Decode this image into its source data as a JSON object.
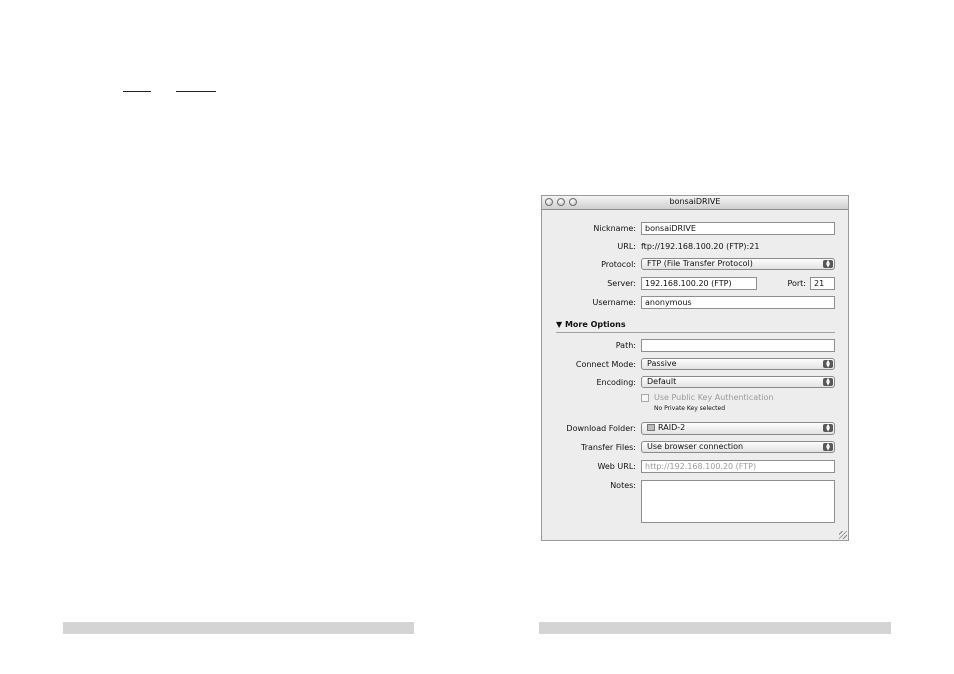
{
  "window": {
    "title": "bonsaiDRIVE"
  },
  "form": {
    "nickname": {
      "label": "Nickname:",
      "value": "bonsaiDRIVE"
    },
    "url": {
      "label": "URL:",
      "value": "ftp://192.168.100.20 (FTP):21"
    },
    "protocol": {
      "label": "Protocol:",
      "value": "FTP (File Transfer Protocol)"
    },
    "server": {
      "label": "Server:",
      "value": "192.168.100.20 (FTP)"
    },
    "port": {
      "label": "Port:",
      "value": "21"
    },
    "username": {
      "label": "Username:",
      "value": "anonymous"
    }
  },
  "more_options": {
    "title": "More Options",
    "path": {
      "label": "Path:",
      "value": ""
    },
    "connect_mode": {
      "label": "Connect Mode:",
      "value": "Passive"
    },
    "encoding": {
      "label": "Encoding:",
      "value": "Default"
    },
    "public_key": {
      "label": "Use Public Key Authentication",
      "note": "No Private Key selected"
    },
    "download_folder": {
      "label": "Download Folder:",
      "value": "RAID-2"
    },
    "transfer_files": {
      "label": "Transfer Files:",
      "value": "Use browser connection"
    },
    "web_url": {
      "label": "Web URL:",
      "placeholder": "http://192.168.100.20 (FTP)"
    },
    "notes": {
      "label": "Notes:",
      "value": ""
    }
  }
}
